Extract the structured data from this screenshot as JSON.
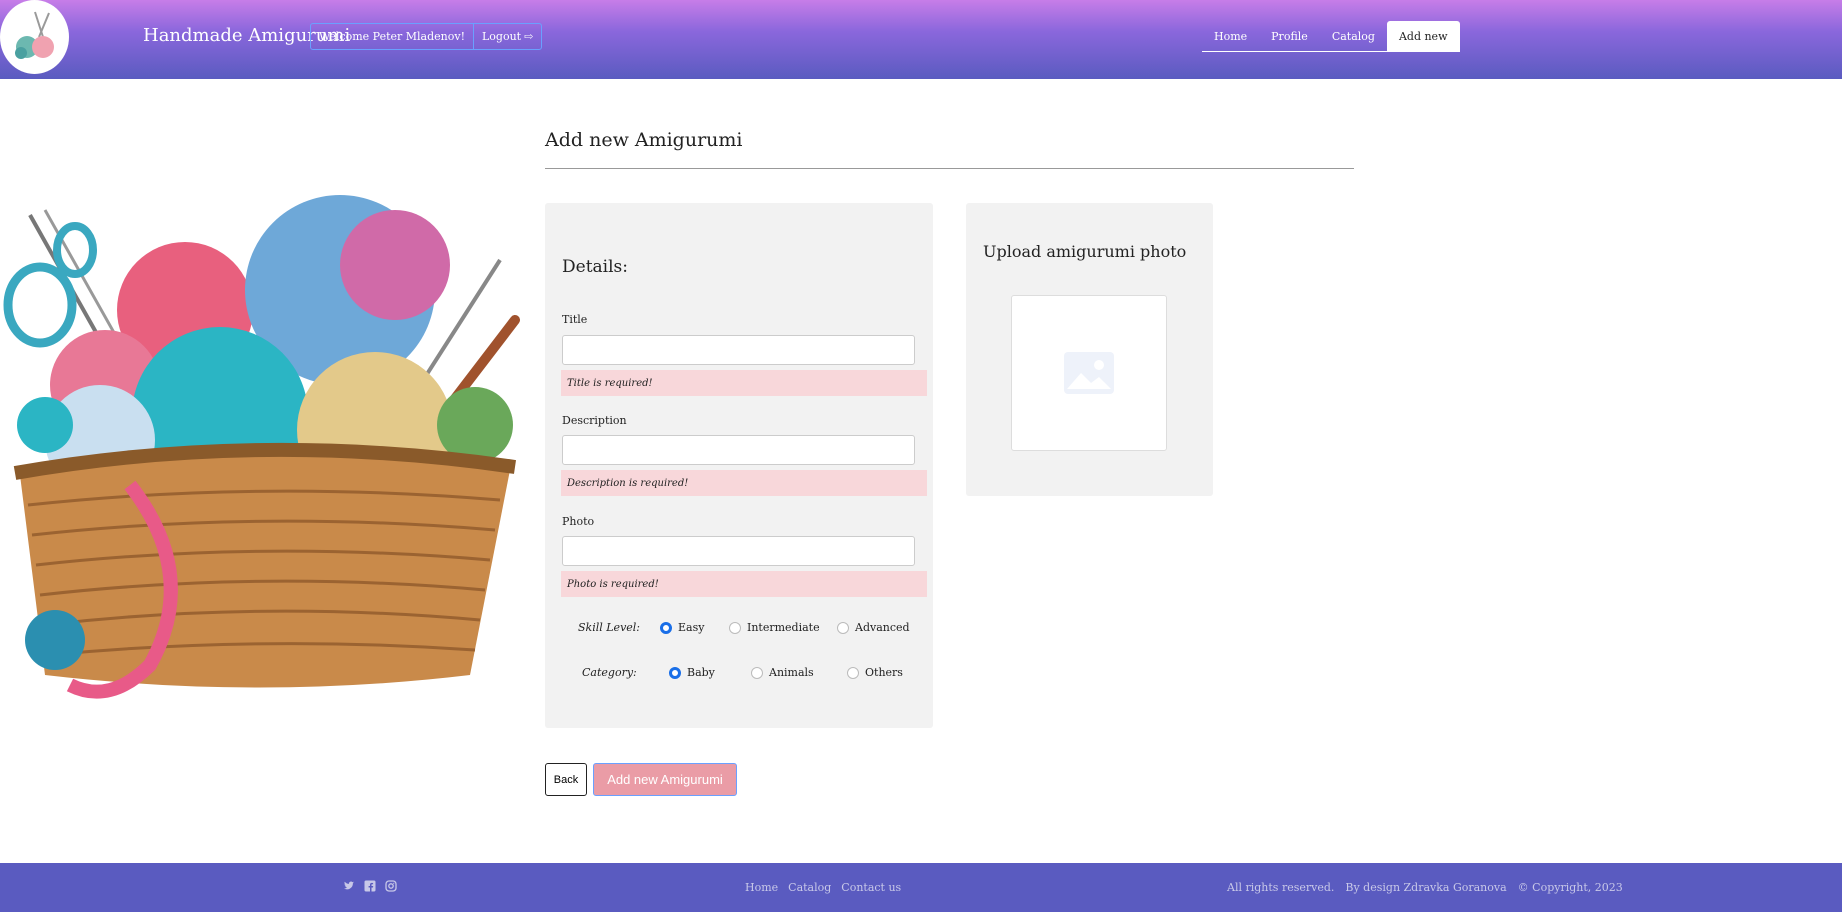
{
  "header": {
    "brand": "Handmade Amigurumi",
    "welcome": "Welcome Peter Mladenov!",
    "logout": "Logout",
    "nav": [
      "Home",
      "Profile",
      "Catalog",
      "Add new"
    ],
    "active_nav": "Add new"
  },
  "main": {
    "title": "Add new Amigurumi",
    "details": {
      "heading": "Details:",
      "fields": [
        {
          "label": "Title",
          "value": "",
          "error": "Title is required!"
        },
        {
          "label": "Description",
          "value": "",
          "error": "Description is required!"
        },
        {
          "label": "Photo",
          "value": "",
          "error": "Photo is required!"
        }
      ],
      "skill_level": {
        "label": "Skill Level:",
        "options": [
          "Easy",
          "Intermediate",
          "Advanced"
        ],
        "selected": "Easy"
      },
      "category": {
        "label": "Category:",
        "options": [
          "Baby",
          "Animals",
          "Others"
        ],
        "selected": "Baby"
      }
    },
    "upload": {
      "heading": "Upload amigurumi photo"
    },
    "buttons": {
      "back": "Back",
      "add": "Add new Amigurumi"
    }
  },
  "footer": {
    "social_icons": [
      "twitter-icon",
      "facebook-icon",
      "instagram-icon"
    ],
    "links": [
      "Home",
      "Catalog",
      "Contact us"
    ],
    "rights": "All rights reserved.",
    "design": "By design Zdravka Goranova",
    "copyright": "© Copyright, 2023"
  },
  "colors": {
    "header_top": "#c77de8",
    "header_bottom": "#5a5bc0",
    "error_bg": "#f8d7da",
    "add_button": "#ea9ca6",
    "radio_selected": "#1a6fe8"
  }
}
